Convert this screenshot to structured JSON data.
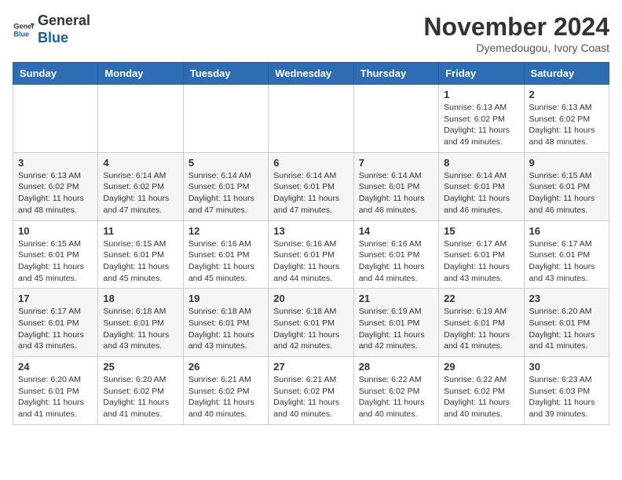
{
  "logo": {
    "general": "General",
    "blue": "Blue"
  },
  "title": "November 2024",
  "location": "Dyemedougou, Ivory Coast",
  "weekdays": [
    "Sunday",
    "Monday",
    "Tuesday",
    "Wednesday",
    "Thursday",
    "Friday",
    "Saturday"
  ],
  "weeks": [
    [
      {
        "day": "",
        "info": ""
      },
      {
        "day": "",
        "info": ""
      },
      {
        "day": "",
        "info": ""
      },
      {
        "day": "",
        "info": ""
      },
      {
        "day": "",
        "info": ""
      },
      {
        "day": "1",
        "info": "Sunrise: 6:13 AM\nSunset: 6:02 PM\nDaylight: 11 hours and 49 minutes."
      },
      {
        "day": "2",
        "info": "Sunrise: 6:13 AM\nSunset: 6:02 PM\nDaylight: 11 hours and 48 minutes."
      }
    ],
    [
      {
        "day": "3",
        "info": "Sunrise: 6:13 AM\nSunset: 6:02 PM\nDaylight: 11 hours and 48 minutes."
      },
      {
        "day": "4",
        "info": "Sunrise: 6:14 AM\nSunset: 6:02 PM\nDaylight: 11 hours and 47 minutes."
      },
      {
        "day": "5",
        "info": "Sunrise: 6:14 AM\nSunset: 6:01 PM\nDaylight: 11 hours and 47 minutes."
      },
      {
        "day": "6",
        "info": "Sunrise: 6:14 AM\nSunset: 6:01 PM\nDaylight: 11 hours and 47 minutes."
      },
      {
        "day": "7",
        "info": "Sunrise: 6:14 AM\nSunset: 6:01 PM\nDaylight: 11 hours and 46 minutes."
      },
      {
        "day": "8",
        "info": "Sunrise: 6:14 AM\nSunset: 6:01 PM\nDaylight: 11 hours and 46 minutes."
      },
      {
        "day": "9",
        "info": "Sunrise: 6:15 AM\nSunset: 6:01 PM\nDaylight: 11 hours and 46 minutes."
      }
    ],
    [
      {
        "day": "10",
        "info": "Sunrise: 6:15 AM\nSunset: 6:01 PM\nDaylight: 11 hours and 45 minutes."
      },
      {
        "day": "11",
        "info": "Sunrise: 6:15 AM\nSunset: 6:01 PM\nDaylight: 11 hours and 45 minutes."
      },
      {
        "day": "12",
        "info": "Sunrise: 6:16 AM\nSunset: 6:01 PM\nDaylight: 11 hours and 45 minutes."
      },
      {
        "day": "13",
        "info": "Sunrise: 6:16 AM\nSunset: 6:01 PM\nDaylight: 11 hours and 44 minutes."
      },
      {
        "day": "14",
        "info": "Sunrise: 6:16 AM\nSunset: 6:01 PM\nDaylight: 11 hours and 44 minutes."
      },
      {
        "day": "15",
        "info": "Sunrise: 6:17 AM\nSunset: 6:01 PM\nDaylight: 11 hours and 43 minutes."
      },
      {
        "day": "16",
        "info": "Sunrise: 6:17 AM\nSunset: 6:01 PM\nDaylight: 11 hours and 43 minutes."
      }
    ],
    [
      {
        "day": "17",
        "info": "Sunrise: 6:17 AM\nSunset: 6:01 PM\nDaylight: 11 hours and 43 minutes."
      },
      {
        "day": "18",
        "info": "Sunrise: 6:18 AM\nSunset: 6:01 PM\nDaylight: 11 hours and 43 minutes."
      },
      {
        "day": "19",
        "info": "Sunrise: 6:18 AM\nSunset: 6:01 PM\nDaylight: 11 hours and 43 minutes."
      },
      {
        "day": "20",
        "info": "Sunrise: 6:18 AM\nSunset: 6:01 PM\nDaylight: 11 hours and 42 minutes."
      },
      {
        "day": "21",
        "info": "Sunrise: 6:19 AM\nSunset: 6:01 PM\nDaylight: 11 hours and 42 minutes."
      },
      {
        "day": "22",
        "info": "Sunrise: 6:19 AM\nSunset: 6:01 PM\nDaylight: 11 hours and 41 minutes."
      },
      {
        "day": "23",
        "info": "Sunrise: 6:20 AM\nSunset: 6:01 PM\nDaylight: 11 hours and 41 minutes."
      }
    ],
    [
      {
        "day": "24",
        "info": "Sunrise: 6:20 AM\nSunset: 6:01 PM\nDaylight: 11 hours and 41 minutes."
      },
      {
        "day": "25",
        "info": "Sunrise: 6:20 AM\nSunset: 6:02 PM\nDaylight: 11 hours and 41 minutes."
      },
      {
        "day": "26",
        "info": "Sunrise: 6:21 AM\nSunset: 6:02 PM\nDaylight: 11 hours and 40 minutes."
      },
      {
        "day": "27",
        "info": "Sunrise: 6:21 AM\nSunset: 6:02 PM\nDaylight: 11 hours and 40 minutes."
      },
      {
        "day": "28",
        "info": "Sunrise: 6:22 AM\nSunset: 6:02 PM\nDaylight: 11 hours and 40 minutes."
      },
      {
        "day": "29",
        "info": "Sunrise: 6:22 AM\nSunset: 6:02 PM\nDaylight: 11 hours and 40 minutes."
      },
      {
        "day": "30",
        "info": "Sunrise: 6:23 AM\nSunset: 6:03 PM\nDaylight: 11 hours and 39 minutes."
      }
    ]
  ]
}
